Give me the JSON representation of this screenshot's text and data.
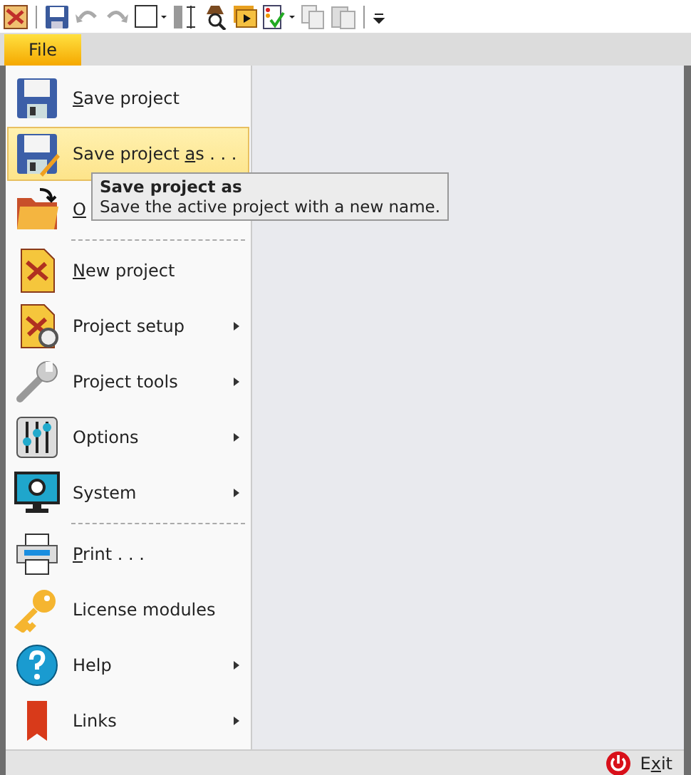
{
  "tabs": [
    {
      "label": "File",
      "selected": true
    }
  ],
  "menu": {
    "items": [
      {
        "kind": "item",
        "key": "S",
        "post": "ave project",
        "submenu": false,
        "selected": false
      },
      {
        "kind": "item",
        "pre": "Save project ",
        "key": "a",
        "post": "s . . .",
        "submenu": false,
        "selected": true
      },
      {
        "kind": "item",
        "key": "O",
        "submenu": false,
        "selected": false
      },
      {
        "kind": "separator"
      },
      {
        "kind": "item",
        "key": "N",
        "post": "ew project",
        "submenu": false,
        "selected": false
      },
      {
        "kind": "item",
        "pre": "Project setup",
        "submenu": true,
        "selected": false
      },
      {
        "kind": "item",
        "pre": "Project tools",
        "submenu": true,
        "selected": false
      },
      {
        "kind": "item",
        "pre": "Options",
        "submenu": true,
        "selected": false
      },
      {
        "kind": "item",
        "pre": "System",
        "submenu": true,
        "selected": false
      },
      {
        "kind": "separator"
      },
      {
        "kind": "item",
        "key": "P",
        "post": "rint . . .",
        "submenu": false,
        "selected": false
      },
      {
        "kind": "item",
        "pre": "License modules",
        "submenu": false,
        "selected": false
      },
      {
        "kind": "item",
        "pre": "Help",
        "submenu": true,
        "selected": false
      },
      {
        "kind": "item",
        "pre": "Links",
        "submenu": true,
        "selected": false
      }
    ]
  },
  "tooltip": {
    "title": "Save project as",
    "text": "Save the active project with a new name."
  },
  "exit": {
    "pre": "E",
    "key": "x",
    "post": "it"
  }
}
